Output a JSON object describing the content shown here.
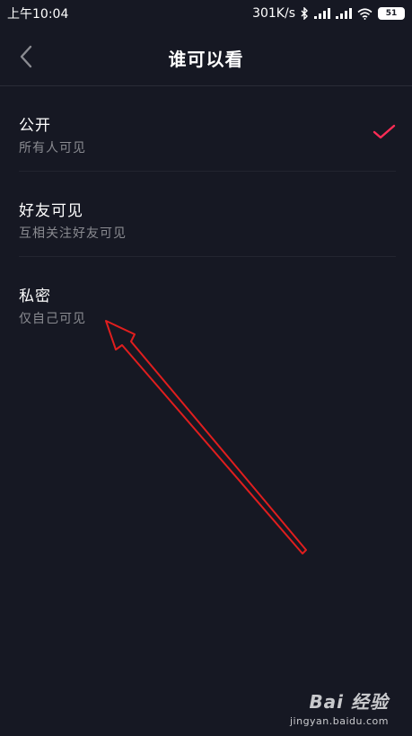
{
  "status_bar": {
    "time": "上午10:04",
    "network_speed": "301K/s",
    "battery": "51"
  },
  "header": {
    "title": "谁可以看"
  },
  "options": [
    {
      "title": "公开",
      "subtitle": "所有人可见",
      "selected": true
    },
    {
      "title": "好友可见",
      "subtitle": "互相关注好友可见",
      "selected": false
    },
    {
      "title": "私密",
      "subtitle": "仅自己可见",
      "selected": false
    }
  ],
  "colors": {
    "background": "#161823",
    "check": "#fe2c55",
    "annotation_arrow": "#e01e1e"
  },
  "watermark": {
    "logo": "Bai 经验",
    "url": "jingyan.baidu.com"
  }
}
